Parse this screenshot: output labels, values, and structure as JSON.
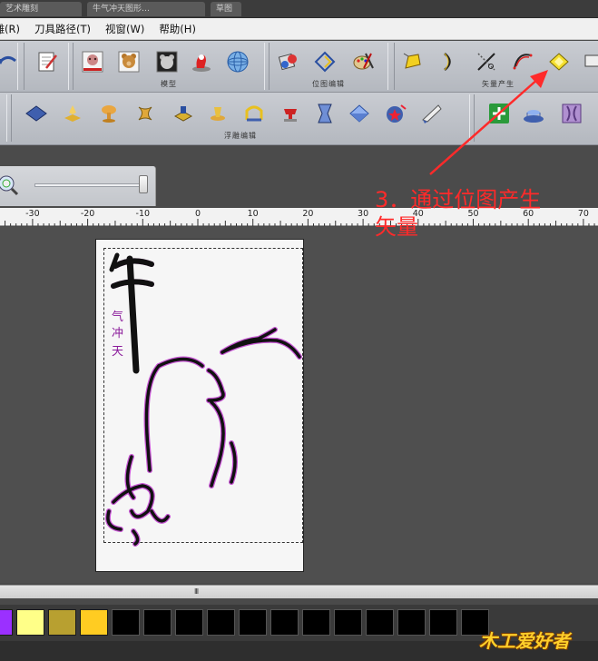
{
  "window": {
    "tabs": [
      "艺术雕刻",
      "牛气冲天图形…",
      "草图"
    ]
  },
  "menu": {
    "items": [
      "浮雕(R)",
      "刀具路径(T)",
      "视窗(W)",
      "帮助(H)"
    ]
  },
  "toolbar_row1": {
    "groups": [
      {
        "label": "模型"
      },
      {
        "label": "位图编辑"
      },
      {
        "label": "矢量产生"
      }
    ]
  },
  "toolbar_row2": {
    "groups": [
      {
        "label": "浮雕编辑"
      }
    ]
  },
  "ruler": {
    "ticks": [
      "-30",
      "-20",
      "-10",
      "0",
      "10",
      "20",
      "30",
      "40",
      "50",
      "60",
      "70"
    ]
  },
  "canvas": {
    "calligraphy_main": "牛",
    "calligraphy_sub": "气冲天"
  },
  "annotation": {
    "line1": "3．通过位图产生",
    "line2": "矢量",
    "color": "#ff2a2a"
  },
  "palette": {
    "colors": [
      "#9b30ff",
      "#ffff88",
      "#b8a030",
      "#ffcc22",
      "#000000",
      "#000000",
      "#000000",
      "#000000",
      "#000000",
      "#000000",
      "#000000",
      "#000000",
      "#000000",
      "#000000",
      "#000000",
      "#000000"
    ]
  },
  "scrollbar": {
    "grip": "III"
  },
  "watermark": {
    "text": "木工爱好者"
  }
}
